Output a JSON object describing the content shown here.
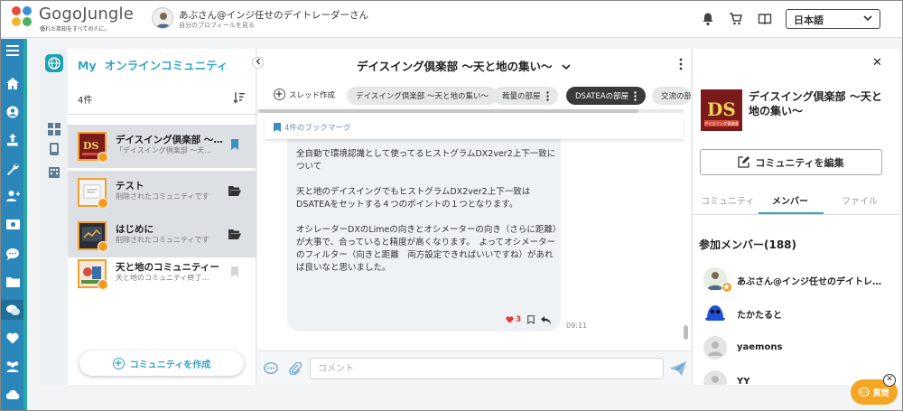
{
  "header": {
    "brand": "GogoJungle",
    "tagline": "優れた英知をすべての人に。",
    "profile_name": "あぶさん@インジ任せのデイトレーダーさん",
    "profile_link": "自分のプロフィールを見る",
    "language": "日本語"
  },
  "rail": {
    "items": [
      "menu-icon",
      "home-icon",
      "user-icon",
      "upload-icon",
      "wrench-icon",
      "add-user-icon",
      "money-icon",
      "chat-bubble-icon",
      "folder-icon",
      "messages-icon",
      "heart-icon",
      "group-icon",
      "cloud-icon"
    ]
  },
  "community_list": {
    "my_label": "My",
    "title": "オンラインコミュニティ",
    "count": "4件",
    "items": [
      {
        "name": "デイスイング倶楽部 ～…",
        "sub": "「デイスイング倶楽部 ～天…",
        "icon": "bookmark-icon"
      },
      {
        "name": "テスト",
        "sub": "削除されたコミュニティです",
        "icon": "folder-icon"
      },
      {
        "name": "はじめに",
        "sub": "削除されたコミュニティです",
        "icon": "folder-icon"
      },
      {
        "name": "天と地のコミュニティー",
        "sub": "天と地のコミュニティ終了…",
        "icon": "bookmark-icon"
      }
    ],
    "create_label": "コミュニティを作成"
  },
  "chat": {
    "title": "デイスイング倶楽部 ～天と地の集い～",
    "thread_create": "スレッド作成",
    "tabs": [
      {
        "label": "デイスイング倶楽部 ～天と地の集い～",
        "active": false,
        "menu": false
      },
      {
        "label": "裁量の部屋",
        "active": false,
        "menu": true
      },
      {
        "label": "DSATEAの部屋",
        "active": true,
        "menu": true
      },
      {
        "label": "交流の部",
        "active": false,
        "menu": false
      }
    ],
    "bookmarks": "4件のブックマーク",
    "message": {
      "paragraphs": [
        "全自動で環境認識として使ってるヒストグラムDX2ver2上下一致について",
        "天と地のデイスイングでもヒストグラムDX2ver2上下一致はDSATEAをセットする４つのポイントの１つとなります。",
        "オシレーターDXのLimeの向きとオシメーターの向き（さらに距離）が大事で、合っていると精度が高くなります。　よってオシメーターのフィルター（向きと距離　両方設定できればいいですね）があれば良いなと思いました。"
      ],
      "likes": "3",
      "time": "09:11"
    },
    "comment_placeholder": "コメント"
  },
  "detail": {
    "name": "デイスイング倶楽部 ～天と地の集い～",
    "thumb_text": "DS",
    "thumb_caption": "デイスイング倶楽部",
    "edit_label": "コミュニティを編集",
    "tabs": [
      "コミュニティ",
      "メンバー",
      "ファイル"
    ],
    "members_title": "参加メンバー(188)",
    "members": [
      {
        "name": "あぶさん@インジ任せのデイトレ…",
        "owner": true
      },
      {
        "name": "たかたると",
        "owner": false
      },
      {
        "name": "yaemons",
        "owner": false
      },
      {
        "name": "YY",
        "owner": false
      }
    ]
  },
  "help": {
    "label": "質問"
  },
  "colors": {
    "rail": "#2b87b9",
    "accent": "#35a3c6",
    "lock": "#f59a1b",
    "active_tab": "#3a3a3a",
    "like": "#e23c3c",
    "help": "#f5a623"
  }
}
